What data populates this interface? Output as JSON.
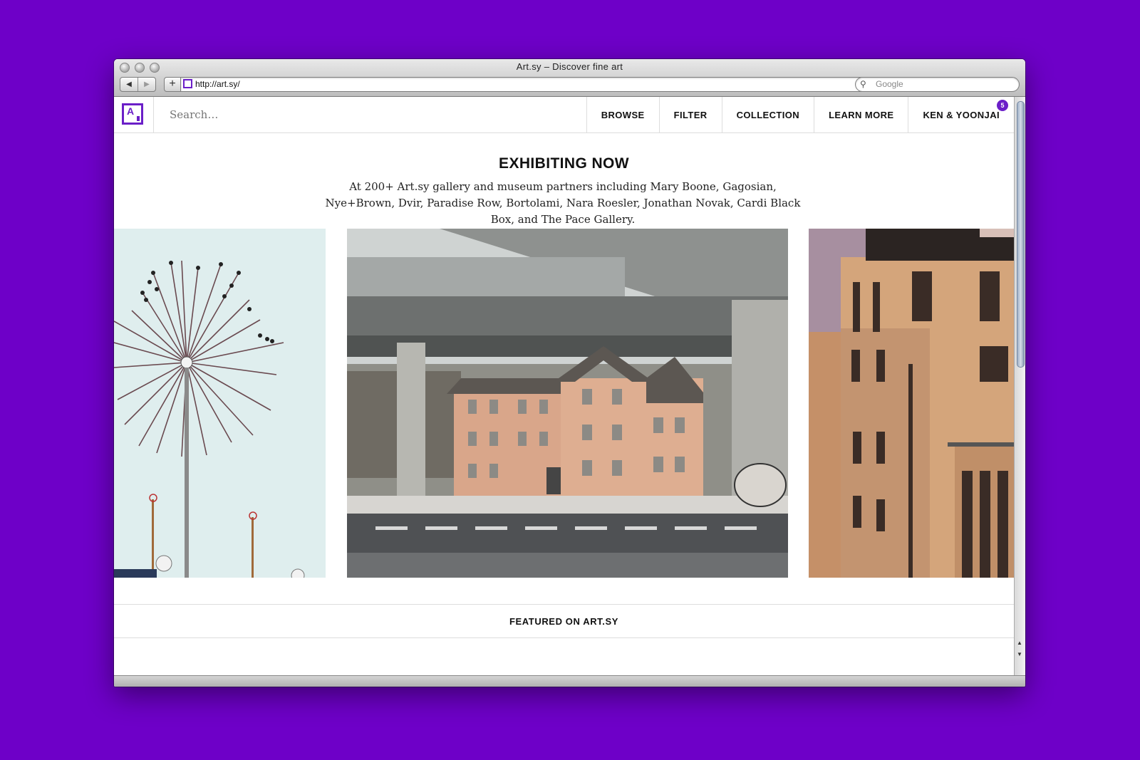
{
  "browser": {
    "window_title": "Art.sy – Discover fine art",
    "back_glyph": "◀",
    "forward_glyph": "▶",
    "add_glyph": "+",
    "url": "http://art.sy/",
    "reload_glyph": "↻",
    "search_placeholder": "Google",
    "search_glyph": "⚲"
  },
  "header": {
    "logo_letter": "A",
    "search_placeholder": "Search…",
    "nav": [
      {
        "label": "BROWSE"
      },
      {
        "label": "FILTER"
      },
      {
        "label": "COLLECTION"
      },
      {
        "label": "LEARN MORE"
      },
      {
        "label": "KEN & YOONJAI",
        "badge": "5"
      }
    ]
  },
  "main": {
    "title": "EXHIBITING NOW",
    "description": "At 200+ Art.sy gallery and museum partners including Mary Boone, Gagosian, Nye+Brown, Dvir, Paradise Row, Bortolami, Nara Roesler, Jonathan Novak, Cardi Black Box, and The Pace Gallery.",
    "artworks": [
      {
        "subject": "lamp-with-birds"
      },
      {
        "subject": "house-under-overpass"
      },
      {
        "subject": "building-at-dusk"
      }
    ],
    "featured_label": "FEATURED ON ART.SY"
  },
  "colors": {
    "background": "#6e00c8",
    "accent": "#6b1fc8"
  },
  "scrollbar": {
    "up_glyph": "▲",
    "down_glyph": "▼"
  }
}
